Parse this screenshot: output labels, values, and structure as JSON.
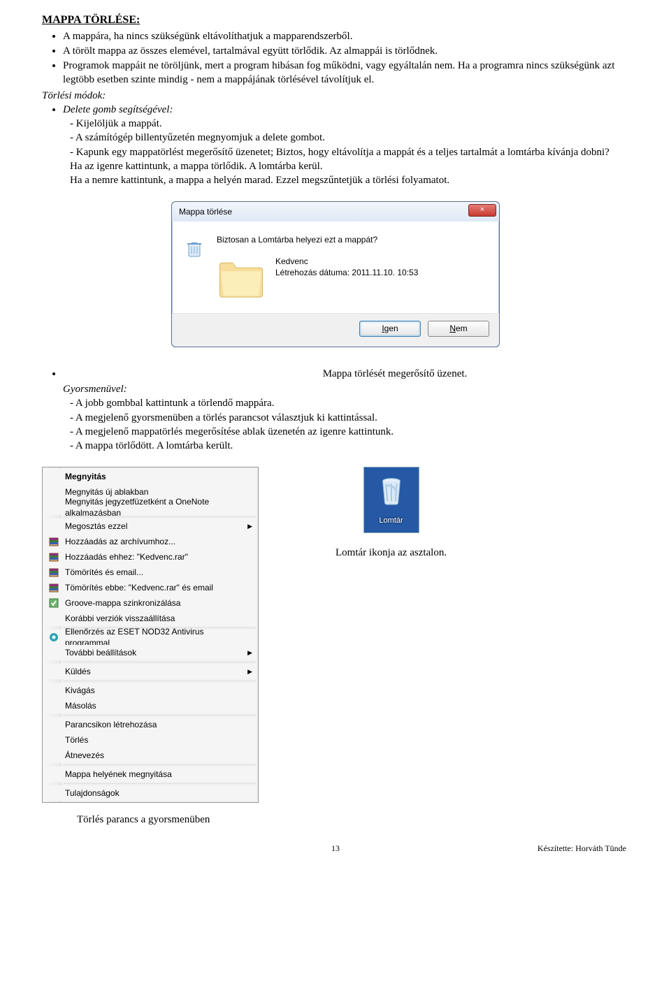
{
  "section_title": "MAPPA TÖRLÉSE:",
  "bullets_intro": [
    "A mappára, ha nincs szükségünk eltávolíthatjuk a mapparendszerből.",
    "A törölt mappa az összes elemével, tartalmával együtt törlődik. Az almappái is törlődnek.",
    "Programok mappáit ne töröljünk, mert a program hibásan fog működni, vagy egyáltalán nem. Ha a programra nincs szükségünk azt legtöbb esetben szinte mindig - nem a mappájának törlésével távolítjuk el."
  ],
  "torlesi_modok": "Törlési módok:",
  "delete_gomb": "Delete gomb segítségével:",
  "delete_steps": [
    "- Kijelöljük a mappát.",
    "- A számítógép billentyűzetén megnyomjuk a delete gombot.",
    "- Kapunk egy mappatörlést megerősítő üzenetet; Biztos, hogy eltávolítja a mappát és a teljes tartalmát a lomtárba kívánja dobni?",
    "Ha az igenre kattintunk, a mappa törlődik. A lomtárba kerül.",
    "Ha a nemre kattintunk, a mappa a helyén marad. Ezzel megszűntetjük a törlési folyamatot."
  ],
  "dialog": {
    "title": "Mappa törlése",
    "close": "×",
    "question": "Biztosan a Lomtárba helyezi ezt a mappát?",
    "name": "Kedvenc",
    "date": "Létrehozás dátuma: 2011.11.10. 10:53",
    "yes_pre": "I",
    "yes_post": "gen",
    "no_pre": "N",
    "no_post": "em"
  },
  "caption1": "Mappa törlését megerősítő üzenet.",
  "gyorsmenuvel": "Gyorsmenüvel:",
  "gyors_steps": [
    "- A jobb gombbal kattintunk a törlendő mappára.",
    "- A megjelenő gyorsmenüben a törlés parancsot választjuk ki kattintással.",
    "- A megjelenő mappatörlés megerősítése ablak üzenetén az igenre kattintunk.",
    "- A mappa törlődött. A lomtárba került."
  ],
  "context_menu": {
    "items": [
      {
        "label": "Megnyitás",
        "bold": true,
        "icon": "",
        "arrow": false
      },
      {
        "label": "Megnyitás új ablakban",
        "icon": "",
        "arrow": false
      },
      {
        "label": "Megnyitás jegyzetfüzetként a OneNote alkalmazásban",
        "icon": "",
        "arrow": false
      },
      {
        "sep": true
      },
      {
        "label": "Megosztás ezzel",
        "icon": "",
        "arrow": true
      },
      {
        "label": "Hozzáadás az archívumhoz...",
        "icon": "rar",
        "arrow": false
      },
      {
        "label": "Hozzáadás ehhez: \"Kedvenc.rar\"",
        "icon": "rar",
        "arrow": false
      },
      {
        "label": "Tömörítés és email...",
        "icon": "rar",
        "arrow": false
      },
      {
        "label": "Tömörítés ebbe: \"Kedvenc.rar\" és email",
        "icon": "rar",
        "arrow": false
      },
      {
        "label": "Groove-mappa szinkronizálása",
        "icon": "grv",
        "arrow": false
      },
      {
        "label": "Korábbi verziók visszaállítása",
        "icon": "",
        "arrow": false
      },
      {
        "sep": true
      },
      {
        "label": "Ellenőrzés az ESET NOD32 Antivirus programmal",
        "icon": "eset",
        "arrow": false
      },
      {
        "label": "További beállítások",
        "icon": "",
        "arrow": true
      },
      {
        "sep": true
      },
      {
        "label": "Küldés",
        "icon": "",
        "arrow": true
      },
      {
        "sep": true
      },
      {
        "label": "Kivágás",
        "icon": "",
        "arrow": false
      },
      {
        "label": "Másolás",
        "icon": "",
        "arrow": false
      },
      {
        "sep": true
      },
      {
        "label": "Parancsikon létrehozása",
        "icon": "",
        "arrow": false
      },
      {
        "label": "Törlés",
        "icon": "",
        "arrow": false
      },
      {
        "label": "Átnevezés",
        "icon": "",
        "arrow": false
      },
      {
        "sep": true
      },
      {
        "label": "Mappa helyének megnyitása",
        "icon": "",
        "arrow": false
      },
      {
        "sep": true
      },
      {
        "label": "Tulajdonságok",
        "icon": "",
        "arrow": false
      }
    ]
  },
  "bin": {
    "label": "Lomtár",
    "caption": "Lomtár ikonja az asztalon."
  },
  "caption2": "Törlés parancs a gyorsmenüben",
  "page_number": "13",
  "credit": "Készítette: Horváth Tünde"
}
